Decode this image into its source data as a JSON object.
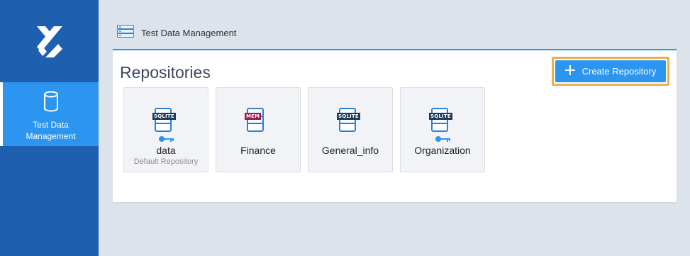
{
  "sidebar": {
    "items": [
      {
        "label": "Test Data Management",
        "icon": "database-icon"
      }
    ]
  },
  "header": {
    "title": "Test Data Management",
    "icon": "server-stack-icon"
  },
  "panel": {
    "title": "Repositories",
    "create_button": {
      "label": "Create Repository",
      "icon": "plus-icon"
    }
  },
  "repositories": [
    {
      "name": "data",
      "subtitle": "Default Repository",
      "badge": "SQLITE",
      "badge_color": "#1c3d5a",
      "has_key": true
    },
    {
      "name": "Finance",
      "subtitle": "",
      "badge": "MEM",
      "badge_color": "#9b1b4a",
      "has_key": false
    },
    {
      "name": "General_info",
      "subtitle": "",
      "badge": "SQLITE",
      "badge_color": "#1c3d5a",
      "has_key": false
    },
    {
      "name": "Organization",
      "subtitle": "",
      "badge": "SQLITE",
      "badge_color": "#1c3d5a",
      "has_key": true
    }
  ],
  "colors": {
    "sidebar_bg": "#1e5fb0",
    "accent": "#2b95f0",
    "highlight": "#f0ad4e"
  }
}
